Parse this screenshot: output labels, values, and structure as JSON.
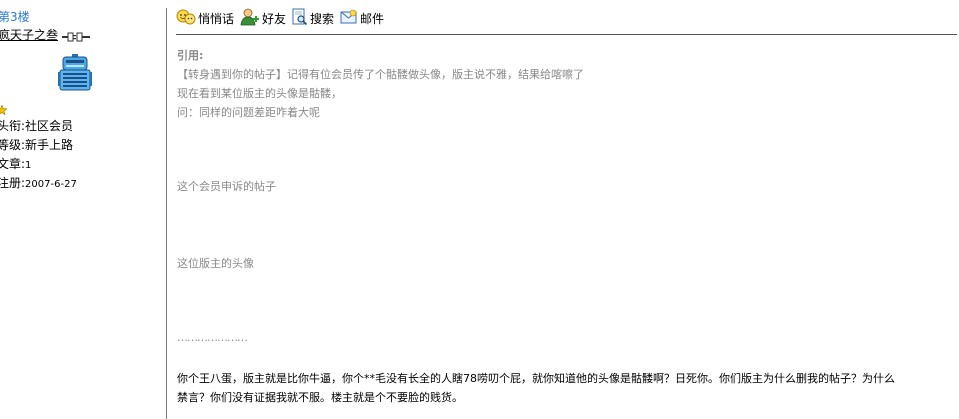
{
  "user": {
    "floor": "第3楼",
    "name": "疯天子之叁",
    "title_label": "头衔:",
    "title_value": "社区会员",
    "level_label": "等级:",
    "level_value": "新手上路",
    "posts_label": "文章:",
    "posts_value": "1",
    "registered_label": "注册:",
    "registered_value": "2007-6-27"
  },
  "toolbar": {
    "whisper": "悄悄话",
    "friend": "好友",
    "search": "搜索",
    "mail": "邮件"
  },
  "post": {
    "quote_label": "引用:",
    "quote_lines": [
      "【转身遇到你的帖子】记得有位会员传了个骷髅做头像，版主说不雅，结果给喀嚓了",
      "现在看到某位版主的头像是骷髅，",
      "问：同样的问题差距咋着大呢"
    ],
    "caption_post": "这个会员申诉的帖子",
    "caption_avatar": "这位版主的头像",
    "ellipsis": "…………………",
    "body_line1": "你个王八蛋，版主就是比你牛逼，你个**毛没有长全的人瞎78唠叨个屁，就你知道他的头像是骷髅啊？日死你。你们版主为什么删我的帖子？为什么",
    "body_line2": "禁言？你们没有证据我就不服。楼主就是个不要脸的贱货。"
  },
  "icons": {
    "whisper": "smiley-chat-icon",
    "friend": "add-friend-icon",
    "search": "search-document-icon",
    "mail": "mail-envelope-icon",
    "online": "online-plug-icon",
    "rank": "star-icon",
    "avatar": "robot-avatar"
  },
  "colors": {
    "floor_link": "#2c7ad3",
    "quote_text": "#888888",
    "divider": "#7a7a7a"
  }
}
